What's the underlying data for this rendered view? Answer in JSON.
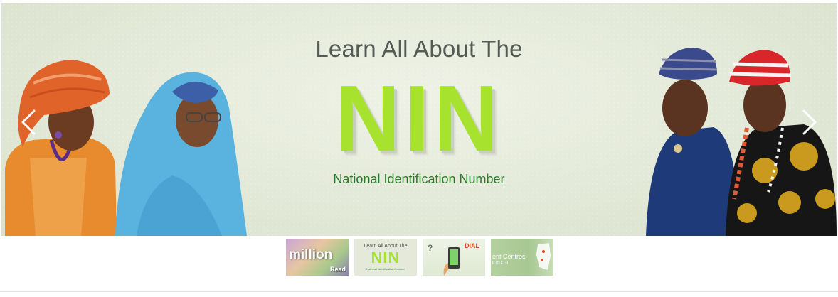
{
  "slider": {
    "heading": "Learn All About The",
    "acronym": "NIN",
    "subtitle": "National Identification Number",
    "colors": {
      "acronym": "#a6e22e",
      "subtitle": "#2a7a2a",
      "heading": "#555a55"
    },
    "prev_icon": "chevron-left-icon",
    "next_icon": "chevron-right-icon"
  },
  "thumbnails": [
    {
      "text": "million",
      "subtext": "Read"
    },
    {
      "top": "Learn All About The",
      "acronym": "NIN",
      "bottom": "National Identification Number",
      "active": true
    },
    {
      "label": "DIAL",
      "mark": "?"
    },
    {
      "text": "ent Centres",
      "subtext": "RIDE H"
    }
  ]
}
